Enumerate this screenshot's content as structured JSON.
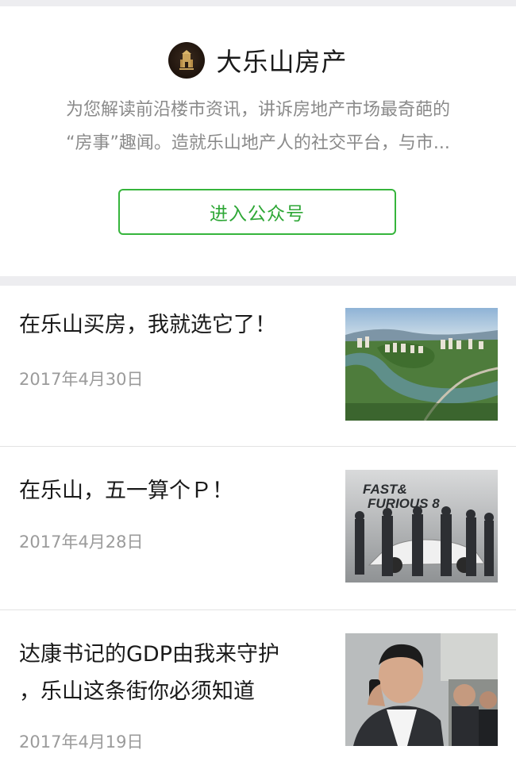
{
  "account": {
    "name": "大乐山房产",
    "logo_icon": "building-logo-icon",
    "description_lines": [
      "为您解读前沿楼市资讯，讲诉房地产市场最奇葩的",
      "“房事”趣闻。造就乐山地产人的社交平台，与市..."
    ],
    "enter_button": "进入公众号",
    "accent_color": "#36b53c"
  },
  "articles": [
    {
      "title_lines": [
        "在乐山买房，我就选它了！"
      ],
      "date": "2017年4月30日",
      "thumbnail": "aerial-city-river-photo"
    },
    {
      "title_lines": [
        "在乐山，五一算个Ｐ！"
      ],
      "date": "2017年4月28日",
      "thumbnail": "fast-furious-8-poster"
    },
    {
      "title_lines": [
        "达康书记的GDP由我来守护",
        "，乐山这条街你必须知道"
      ],
      "date": "2017年4月19日",
      "thumbnail": "man-on-phone-photo"
    }
  ]
}
